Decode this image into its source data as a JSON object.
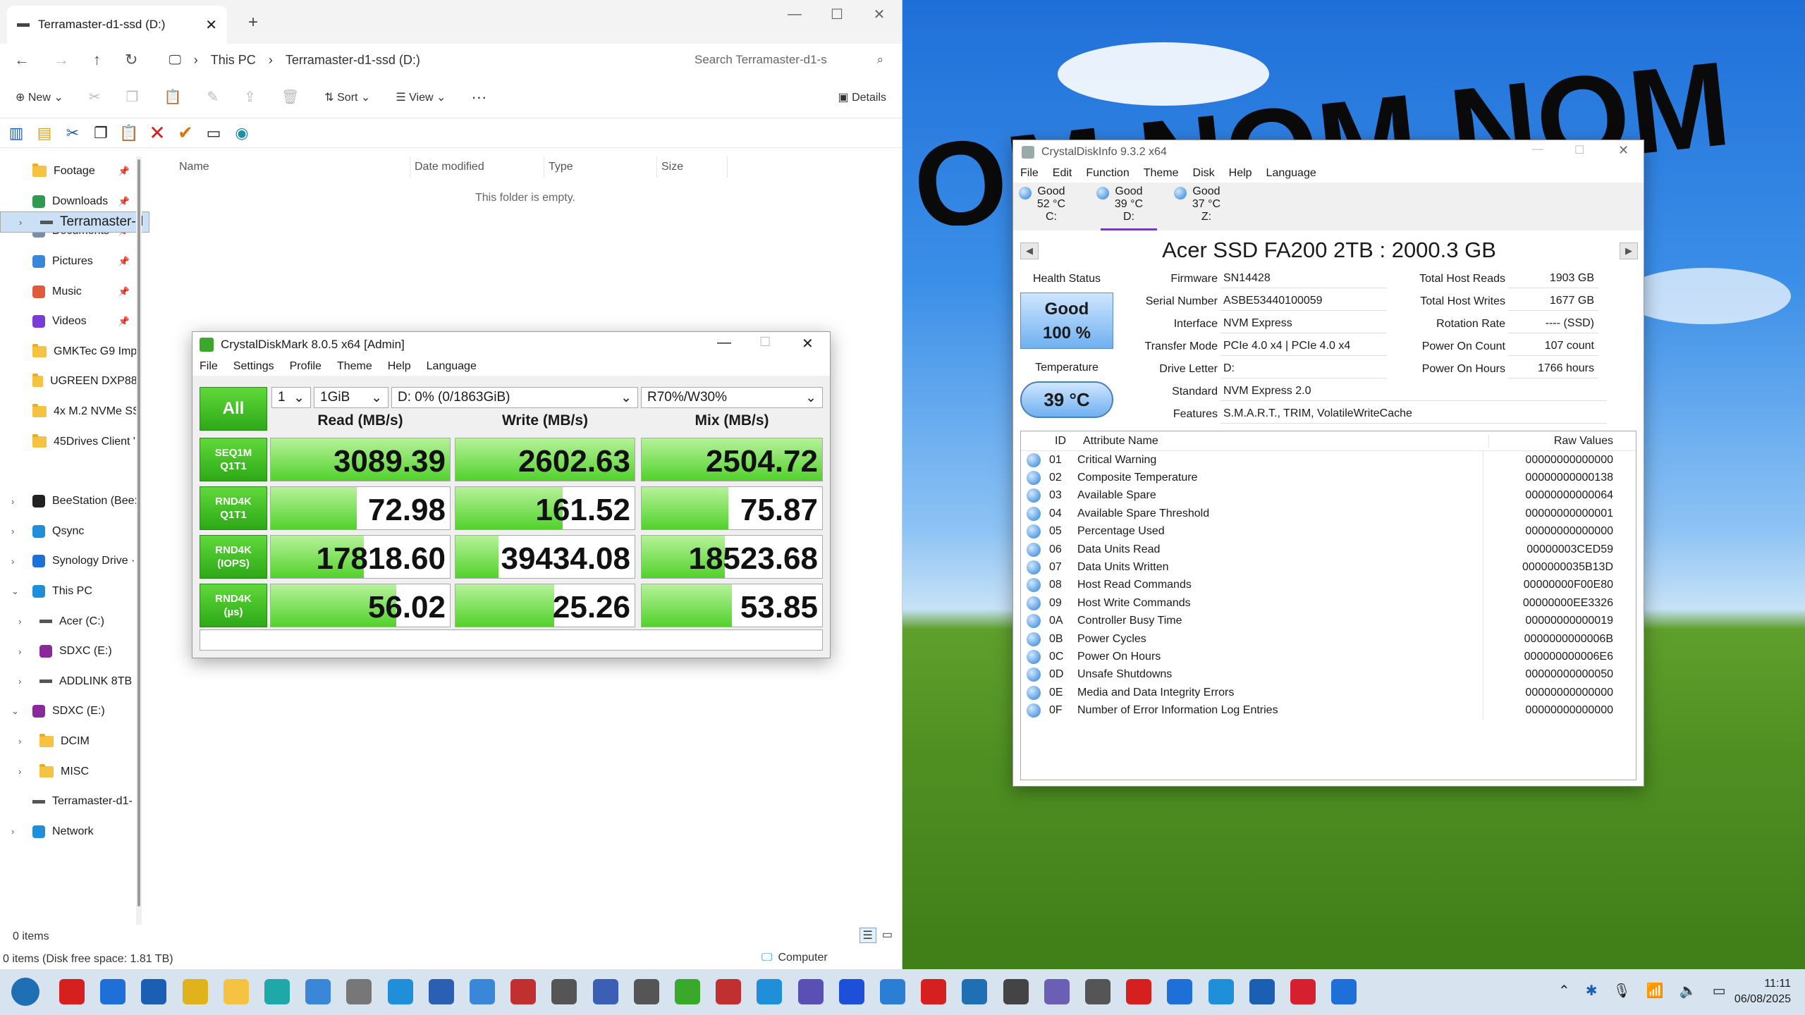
{
  "explorer": {
    "tab_title": "Terramaster-d1-ssd (D:)",
    "breadcrumbs": [
      "This PC",
      "Terramaster-d1-ssd (D:)"
    ],
    "search_placeholder": "Search Terramaster-d1-s",
    "cmd": {
      "new": "New",
      "sort": "Sort",
      "view": "View",
      "more": "···",
      "details": "Details"
    },
    "columns": [
      "Name",
      "Date modified",
      "Type",
      "Size"
    ],
    "empty_text": "This folder is empty.",
    "nav": [
      {
        "label": "Footage",
        "icon": "folder-icon"
      },
      {
        "label": "Downloads",
        "icon": "download-icon"
      },
      {
        "label": "Documents",
        "icon": "documents-icon"
      },
      {
        "label": "Pictures",
        "icon": "pictures-icon"
      },
      {
        "label": "Music",
        "icon": "music-icon"
      },
      {
        "label": "Videos",
        "icon": "videos-icon"
      },
      {
        "label": "GMKTec G9 Imp",
        "icon": "folder-icon"
      },
      {
        "label": "UGREEN DXP88(",
        "icon": "folder-icon"
      },
      {
        "label": "4x M.2 NVMe SS",
        "icon": "folder-icon"
      },
      {
        "label": "45Drives Client '",
        "icon": "folder-icon"
      },
      {
        "label": "BeeStation (Bee:",
        "icon": "beestation-icon"
      },
      {
        "label": "Qsync",
        "icon": "qsync-icon"
      },
      {
        "label": "Synology Drive ·",
        "icon": "synology-icon"
      },
      {
        "label": "This PC",
        "icon": "this-pc-icon"
      },
      {
        "label": "Acer (C:)",
        "icon": "drive-icon"
      },
      {
        "label": "Terramaster-d",
        "icon": "drive-icon"
      },
      {
        "label": "SDXC (E:)",
        "icon": "sd-card-icon"
      },
      {
        "label": "ADDLINK 8TB",
        "icon": "drive-icon"
      },
      {
        "label": "SDXC (E:)",
        "icon": "sd-card-icon"
      },
      {
        "label": "DCIM",
        "icon": "folder-icon"
      },
      {
        "label": "MISC",
        "icon": "folder-icon"
      },
      {
        "label": "Terramaster-d1-",
        "icon": "drive-icon"
      },
      {
        "label": "Network",
        "icon": "network-icon"
      }
    ],
    "status_items": "0 items",
    "status_free": "0 items (Disk free space: 1.81 TB)",
    "status_computer": "Computer"
  },
  "cdm": {
    "title": "CrystalDiskMark 8.0.5 x64 [Admin]",
    "menu": [
      "File",
      "Settings",
      "Profile",
      "Theme",
      "Help",
      "Language"
    ],
    "all_label": "All",
    "count": "1",
    "size": "1GiB",
    "drive": "D: 0% (0/1863GiB)",
    "mix": "R70%/W30%",
    "headers": [
      "Read (MB/s)",
      "Write (MB/s)",
      "Mix (MB/s)"
    ],
    "rows": [
      {
        "l1": "SEQ1M",
        "l2": "Q1T1",
        "read": "3089.39",
        "write": "2602.63",
        "mix": "2504.72",
        "fills": [
          1.0,
          1.0,
          1.0
        ]
      },
      {
        "l1": "RND4K",
        "l2": "Q1T1",
        "read": "72.98",
        "write": "161.52",
        "mix": "75.87",
        "fills": [
          0.48,
          0.6,
          0.48
        ]
      },
      {
        "l1": "RND4K",
        "l2": "(IOPS)",
        "read": "17818.60",
        "write": "39434.08",
        "mix": "18523.68",
        "fills": [
          0.52,
          0.24,
          0.46
        ]
      },
      {
        "l1": "RND4K",
        "l2": "(µs)",
        "read": "56.02",
        "write": "25.26",
        "mix": "53.85",
        "fills": [
          0.7,
          0.55,
          0.5
        ]
      }
    ]
  },
  "cdi": {
    "title": "CrystalDiskInfo 9.3.2 x64",
    "menu": [
      "File",
      "Edit",
      "Function",
      "Theme",
      "Disk",
      "Help",
      "Language"
    ],
    "disks": [
      {
        "status": "Good",
        "temp": "52 °C",
        "letter": "C:"
      },
      {
        "status": "Good",
        "temp": "39 °C",
        "letter": "D:"
      },
      {
        "status": "Good",
        "temp": "37 °C",
        "letter": "Z:"
      }
    ],
    "model": "Acer SSD FA200 2TB : 2000.3 GB",
    "health_label": "Health Status",
    "health_status": "Good",
    "health_pct": "100 %",
    "temp_label": "Temperature",
    "temp_value": "39 °C",
    "firmware_label": "Firmware",
    "firmware": "SN14428",
    "serial_label": "Serial Number",
    "serial": "ASBE53440100059",
    "interface_label": "Interface",
    "interface": "NVM Express",
    "transfer_label": "Transfer Mode",
    "transfer": "PCIe 4.0 x4 | PCIe 4.0 x4",
    "letter_label": "Drive Letter",
    "letter": "D:",
    "standard_label": "Standard",
    "standard": "NVM Express 2.0",
    "features_label": "Features",
    "features": "S.M.A.R.T., TRIM, VolatileWriteCache",
    "reads_label": "Total Host Reads",
    "reads": "1903 GB",
    "writes_label": "Total Host Writes",
    "writes": "1677 GB",
    "rotation_label": "Rotation Rate",
    "rotation": "---- (SSD)",
    "poweron_count_label": "Power On Count",
    "poweron_count": "107 count",
    "poweron_hours_label": "Power On Hours",
    "poweron_hours": "1766 hours",
    "attr_headers": {
      "id": "ID",
      "name": "Attribute Name",
      "raw": "Raw Values"
    },
    "attributes": [
      {
        "id": "01",
        "name": "Critical Warning",
        "raw": "00000000000000"
      },
      {
        "id": "02",
        "name": "Composite Temperature",
        "raw": "00000000000138"
      },
      {
        "id": "03",
        "name": "Available Spare",
        "raw": "00000000000064"
      },
      {
        "id": "04",
        "name": "Available Spare Threshold",
        "raw": "00000000000001"
      },
      {
        "id": "05",
        "name": "Percentage Used",
        "raw": "00000000000000"
      },
      {
        "id": "06",
        "name": "Data Units Read",
        "raw": "00000003CED59"
      },
      {
        "id": "07",
        "name": "Data Units Written",
        "raw": "0000000035B13D"
      },
      {
        "id": "08",
        "name": "Host Read Commands",
        "raw": "00000000F00E80"
      },
      {
        "id": "09",
        "name": "Host Write Commands",
        "raw": "00000000EE3326"
      },
      {
        "id": "0A",
        "name": "Controller Busy Time",
        "raw": "00000000000019"
      },
      {
        "id": "0B",
        "name": "Power Cycles",
        "raw": "0000000000006B"
      },
      {
        "id": "0C",
        "name": "Power On Hours",
        "raw": "000000000006E6"
      },
      {
        "id": "0D",
        "name": "Unsafe Shutdowns",
        "raw": "00000000000050"
      },
      {
        "id": "0E",
        "name": "Media and Data Integrity Errors",
        "raw": "00000000000000"
      },
      {
        "id": "0F",
        "name": "Number of Error Information Log Entries",
        "raw": "00000000000000"
      }
    ]
  },
  "desktop": {
    "graffiti": "OM NOM NOM"
  },
  "taskbar": {
    "time": "11:11",
    "date": "06/08/2025"
  },
  "colors": {
    "cdm_green": "#2ea817",
    "cdi_blue": "#2a7fd5",
    "explorer_select": "#cce0f5"
  }
}
